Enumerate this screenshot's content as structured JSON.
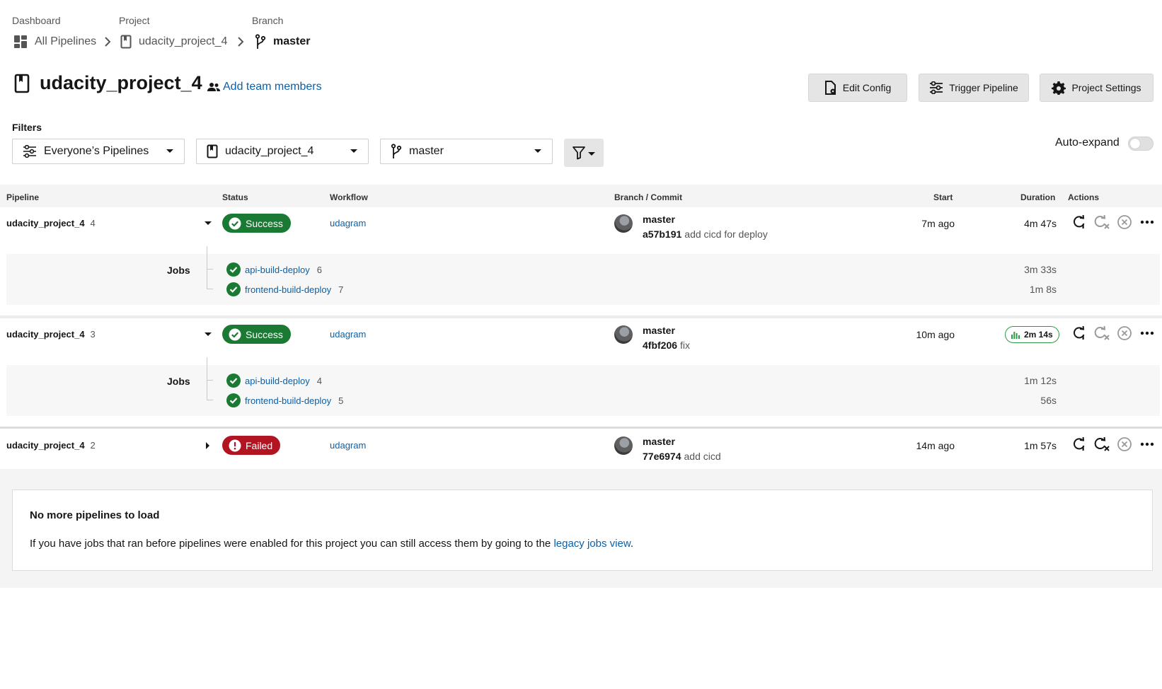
{
  "breadcrumbs": {
    "dashboard": {
      "label": "Dashboard",
      "value": "All Pipelines"
    },
    "project": {
      "label": "Project",
      "value": "udacity_project_4"
    },
    "branch": {
      "label": "Branch",
      "value": "master"
    }
  },
  "header": {
    "title": "udacity_project_4",
    "add_team": "Add team members",
    "buttons": {
      "edit_config": "Edit Config",
      "trigger_pipeline": "Trigger Pipeline",
      "project_settings": "Project Settings"
    }
  },
  "filters": {
    "label": "Filters",
    "pipelines": "Everyone’s Pipelines",
    "project": "udacity_project_4",
    "branch": "master",
    "auto_expand": "Auto-expand"
  },
  "table": {
    "columns": {
      "pipeline": "Pipeline",
      "status": "Status",
      "workflow": "Workflow",
      "branch_commit": "Branch / Commit",
      "start": "Start",
      "duration": "Duration",
      "actions": "Actions"
    },
    "rows": [
      {
        "name": "udacity_project_4",
        "number": "4",
        "status": "Success",
        "workflow": "udagram",
        "branch": "master",
        "sha": "a57b191",
        "message": "add cicd for deploy",
        "start": "7m ago",
        "duration": "4m 47s",
        "jobs_label": "Jobs",
        "jobs": [
          {
            "name": "api-build-deploy",
            "number": "6",
            "duration": "3m 33s"
          },
          {
            "name": "frontend-build-deploy",
            "number": "7",
            "duration": "1m 8s"
          }
        ]
      },
      {
        "name": "udacity_project_4",
        "number": "3",
        "status": "Success",
        "workflow": "udagram",
        "branch": "master",
        "sha": "4fbf206",
        "message": "fix",
        "start": "10m ago",
        "duration": "2m 14s",
        "jobs_label": "Jobs",
        "jobs": [
          {
            "name": "api-build-deploy",
            "number": "4",
            "duration": "1m 12s"
          },
          {
            "name": "frontend-build-deploy",
            "number": "5",
            "duration": "56s"
          }
        ]
      },
      {
        "name": "udacity_project_4",
        "number": "2",
        "status": "Failed",
        "workflow": "udagram",
        "branch": "master",
        "sha": "77e6974",
        "message": "add cicd",
        "start": "14m ago",
        "duration": "1m 57s"
      }
    ]
  },
  "footer": {
    "title": "No more pipelines to load",
    "text": "If you have jobs that ran before pipelines were enabled for this project you can still access them by going to the",
    "link": "legacy jobs view",
    "period": "."
  },
  "colors": {
    "success": "#1a7a33",
    "failed": "#b21521",
    "link": "#0d5fa6"
  }
}
